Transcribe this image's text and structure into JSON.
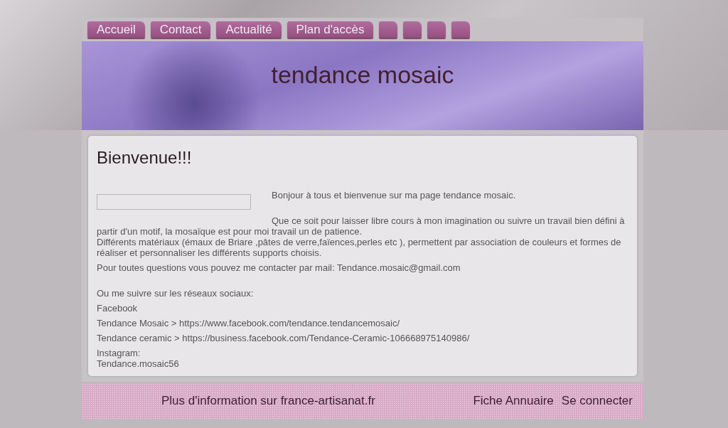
{
  "nav": [
    {
      "kind": "text",
      "label": "Accueil"
    },
    {
      "kind": "text",
      "label": "Contact"
    },
    {
      "kind": "text",
      "label": "Actualité"
    },
    {
      "kind": "text",
      "label": "Plan d'accès"
    },
    {
      "kind": "blank"
    },
    {
      "kind": "blank"
    },
    {
      "kind": "blank"
    },
    {
      "kind": "blank"
    }
  ],
  "site_title": "tendance mosaic",
  "heading": "Bienvenue!!!",
  "intro": "Bonjour à tous et bienvenue sur ma page tendance mosaic.",
  "paragraph": "Que ce soit pour laisser libre cours à mon imagination ou suivre un travail bien défini à partir d'un motif, la mosaïque est pour moi travail un de patience.",
  "materials": "Différents matériaux (émaux de Briare ,pâtes de verre,faïences,perles etc ), permettent par association de couleurs et formes de réaliser et personnaliser les différents supports choisis.",
  "contact": "Pour toutes questions vous pouvez me contacter par mail: Tendance.mosaic@gmail.com",
  "social_intro": "Ou me suivre sur les réseaux sociaux:",
  "social_lines": [
    "Facebook",
    "Tendance Mosaic > https://www.facebook.com/tendance.tendancemosaic/",
    "Tendance ceramic > https://business.facebook.com/Tendance-Ceramic-106668975140986/"
  ],
  "instagram_label": "Instagram:",
  "instagram_handle": "Tendance.mosaic56",
  "footer": {
    "info": "Plus d'information sur france-artisanat.fr",
    "links": [
      "Fiche Annuaire",
      "Se connecter"
    ]
  }
}
